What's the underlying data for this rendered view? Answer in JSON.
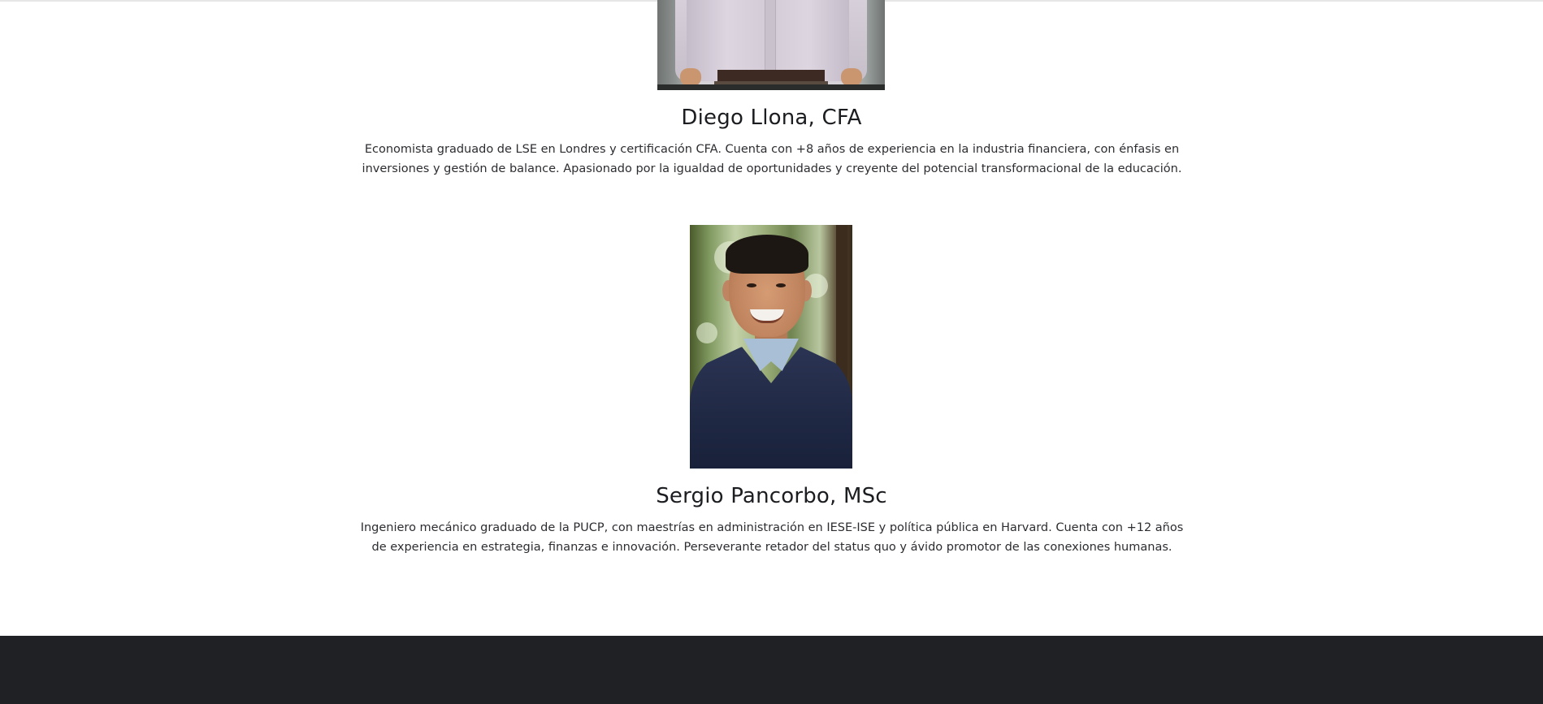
{
  "team": [
    {
      "name": "Diego Llona, CFA",
      "bio": "Economista graduado de LSE en Londres y certificación CFA. Cuenta con +8 años de experiencia en la industria financiera, con énfasis en inversiones y gestión de balance. Apasionado por la igualdad de oportunidades y creyente del potencial transformacional de la educación."
    },
    {
      "name": "Sergio Pancorbo, MSc",
      "bio": "Ingeniero mecánico graduado de la PUCP, con maestrías en administración en IESE-ISE y política pública en Harvard. Cuenta con +12 años de experiencia en estrategia, finanzas e innovación. Perseverante retador del status quo y ávido promotor de las conexiones humanas."
    }
  ]
}
